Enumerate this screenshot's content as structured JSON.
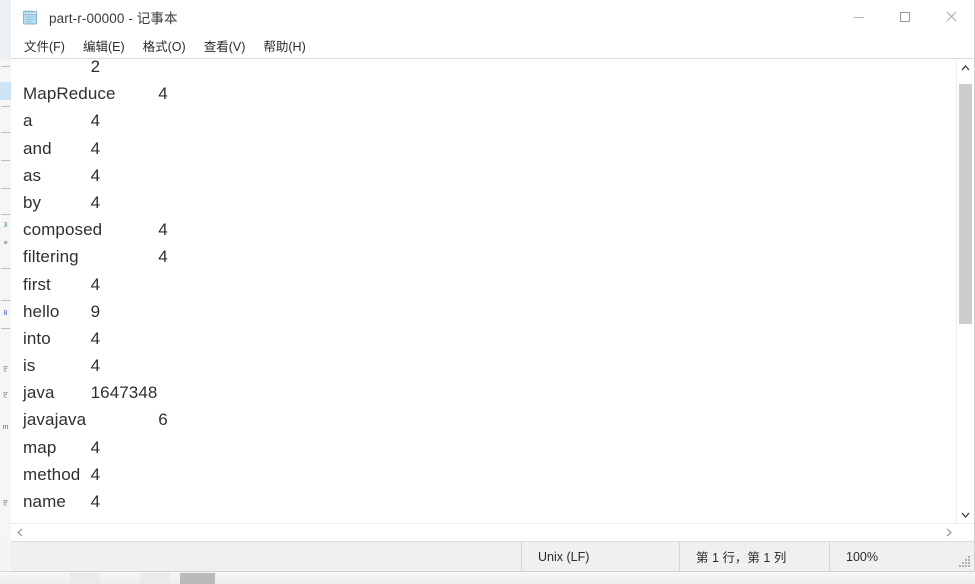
{
  "window": {
    "title": "part-r-00000 - 记事本",
    "icon": "notepad-icon",
    "controls": {
      "minimize": "─",
      "maximize": "☐",
      "close": "✕"
    }
  },
  "menubar": {
    "items": [
      {
        "label": "文件(F)",
        "name": "menu-file"
      },
      {
        "label": "编辑(E)",
        "name": "menu-edit"
      },
      {
        "label": "格式(O)",
        "name": "menu-format"
      },
      {
        "label": "查看(V)",
        "name": "menu-view"
      },
      {
        "label": "帮助(H)",
        "name": "menu-help"
      }
    ]
  },
  "editor": {
    "lines": [
      {
        "key": "",
        "value": "2"
      },
      {
        "key": "MapReduce",
        "value": "4"
      },
      {
        "key": "a",
        "value": "4"
      },
      {
        "key": "and",
        "value": "4"
      },
      {
        "key": "as",
        "value": "4"
      },
      {
        "key": "by",
        "value": "4"
      },
      {
        "key": "composed",
        "value": "4"
      },
      {
        "key": "filtering",
        "value": "4"
      },
      {
        "key": "first",
        "value": "4"
      },
      {
        "key": "hello",
        "value": "9"
      },
      {
        "key": "into",
        "value": "4"
      },
      {
        "key": "is",
        "value": "4"
      },
      {
        "key": "java",
        "value": "1647348"
      },
      {
        "key": "javajava",
        "value": "6"
      },
      {
        "key": "map",
        "value": "4"
      },
      {
        "key": "method",
        "value": "4"
      },
      {
        "key": "name",
        "value": "4"
      }
    ]
  },
  "scrollbars": {
    "vertical": {
      "up_arrow": "ⱏ",
      "down_arrow": "ⱟ"
    },
    "horizontal": {
      "left_arrow": "‹",
      "right_arrow": "›"
    }
  },
  "statusbar": {
    "encoding": "Unix (LF)",
    "position": "第 1 行，第 1 列",
    "zoom": "100%"
  },
  "colors": {
    "window_bg": "#ffffff",
    "text": "#2f2f2f",
    "statusbar_bg": "#f0f0f0",
    "scroll_thumb": "#cdcdcd",
    "icon_blue": "#a8d4ea"
  }
}
